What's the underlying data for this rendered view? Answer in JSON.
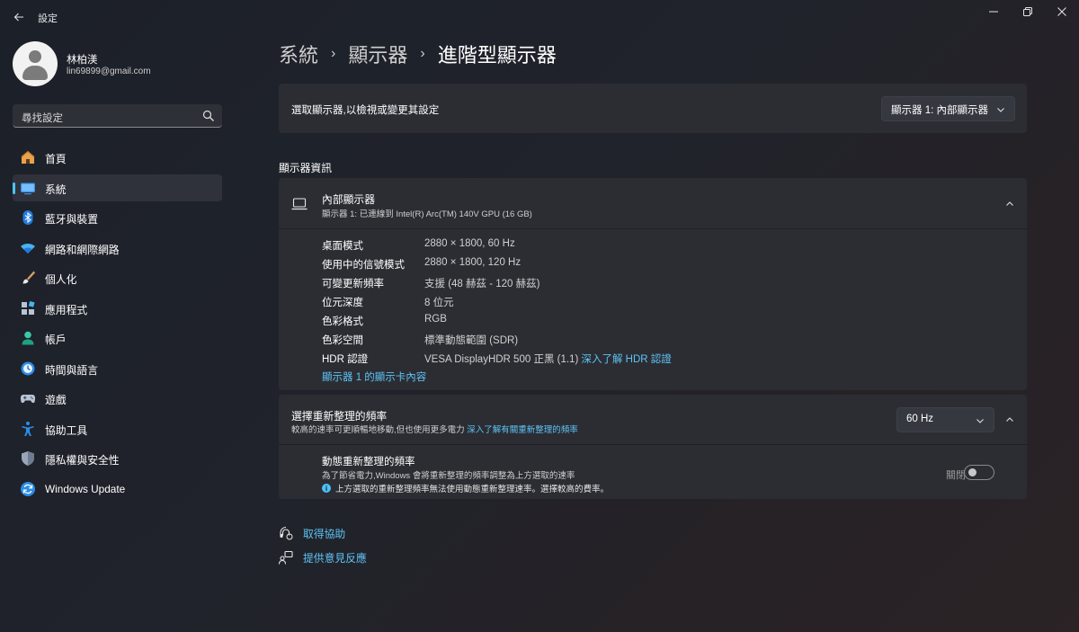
{
  "window": {
    "title": "設定"
  },
  "user": {
    "name": "林柏渼",
    "email": "lin69899@gmail.com"
  },
  "search": {
    "placeholder": "尋找設定"
  },
  "nav": {
    "items": [
      {
        "label": "首頁",
        "icon": "home-icon"
      },
      {
        "label": "系統",
        "icon": "system-icon",
        "active": true
      },
      {
        "label": "藍牙與裝置",
        "icon": "bluetooth-icon"
      },
      {
        "label": "網路和網際網路",
        "icon": "wifi-icon"
      },
      {
        "label": "個人化",
        "icon": "brush-icon"
      },
      {
        "label": "應用程式",
        "icon": "apps-icon"
      },
      {
        "label": "帳戶",
        "icon": "account-icon"
      },
      {
        "label": "時間與語言",
        "icon": "time-language-icon"
      },
      {
        "label": "遊戲",
        "icon": "gaming-icon"
      },
      {
        "label": "協助工具",
        "icon": "accessibility-icon"
      },
      {
        "label": "隱私權與安全性",
        "icon": "shield-icon"
      },
      {
        "label": "Windows Update",
        "icon": "update-icon"
      }
    ]
  },
  "breadcrumb": {
    "items": [
      "系統",
      "顯示器",
      "進階型顯示器"
    ]
  },
  "display_select": {
    "label": "選取顯示器,以檢視或變更其設定",
    "value": "顯示器 1: 內部顯示器"
  },
  "display_info": {
    "section_title": "顯示器資訊",
    "name": "內部顯示器",
    "subtitle": "顯示器 1: 已連線到 Intel(R) Arc(TM) 140V GPU (16 GB)",
    "rows": [
      {
        "key": "桌面模式",
        "value": "2880 × 1800, 60 Hz"
      },
      {
        "key": "使用中的信號模式",
        "value": "2880 × 1800, 120 Hz"
      },
      {
        "key": "可變更新頻率",
        "value": "支援 (48 赫茲 - 120 赫茲)"
      },
      {
        "key": "位元深度",
        "value": "8 位元"
      },
      {
        "key": "色彩格式",
        "value": "RGB"
      },
      {
        "key": "色彩空間",
        "value": "標準動態範圍 (SDR)"
      },
      {
        "key": "HDR 認證",
        "value": "VESA DisplayHDR 500 正黑 (1.1)",
        "link": "深入了解 HDR 認證"
      }
    ],
    "adapter_link": "顯示器 1 的顯示卡內容"
  },
  "refresh_rate": {
    "title": "選擇重新整理的頻率",
    "description": "較高的速率可更順暢地移動,但也使用更多電力",
    "link": "深入了解有關重新整理的頻率",
    "value": "60 Hz",
    "dynamic": {
      "title": "動態重新整理的頻率",
      "description": "為了節省電力,Windows 會將重新整理的頻率調整為上方選取的速率",
      "note": "上方選取的重新整理頻率無法使用動態重新整理速率。選擇較高的費率。",
      "toggle_label": "關閉",
      "toggle_on": false
    }
  },
  "footer": {
    "help": "取得協助",
    "feedback": "提供意見反應"
  },
  "colors": {
    "accent": "#4cc2ff",
    "link": "#5fc4f6",
    "card": "#2b2d33"
  }
}
